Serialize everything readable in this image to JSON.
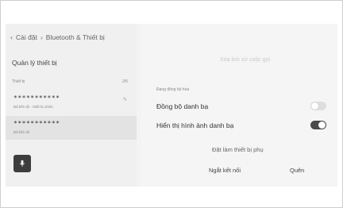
{
  "breadcrumb": {
    "root": "Cài đặt",
    "current": "Bluetooth & Thiết bị"
  },
  "left_panel": {
    "title": "Quản lý thiết bị",
    "list_header": "Thiết bị",
    "list_count": "2/5",
    "devices": [
      {
        "name": "***********",
        "status": "Đã kết nối - thiết bị chính",
        "edit_icon": "pencil-icon"
      },
      {
        "name": "***********",
        "status": "Đã kết nối"
      }
    ],
    "mic_icon": "microphone-icon"
  },
  "right_panel": {
    "clear_history": "Xóa lịch sử cuộc gọi",
    "sync_status": "Đang đồng bộ hóa",
    "settings": [
      {
        "label": "Đồng bộ danh bạ",
        "state": "off"
      },
      {
        "label": "Hiển thị hình ảnh danh bạ",
        "state": "on"
      }
    ],
    "set_secondary": "Đặt làm thiết bị phụ",
    "disconnect": "Ngắt kết nối",
    "forget": "Quên"
  },
  "colors": {
    "screen_bg": "#f3f3f3",
    "selected_row": "#e3e3e3",
    "toggle_on": "#4a4a4a",
    "toggle_off": "#dedede",
    "mic_button": "#3d3d3d"
  }
}
